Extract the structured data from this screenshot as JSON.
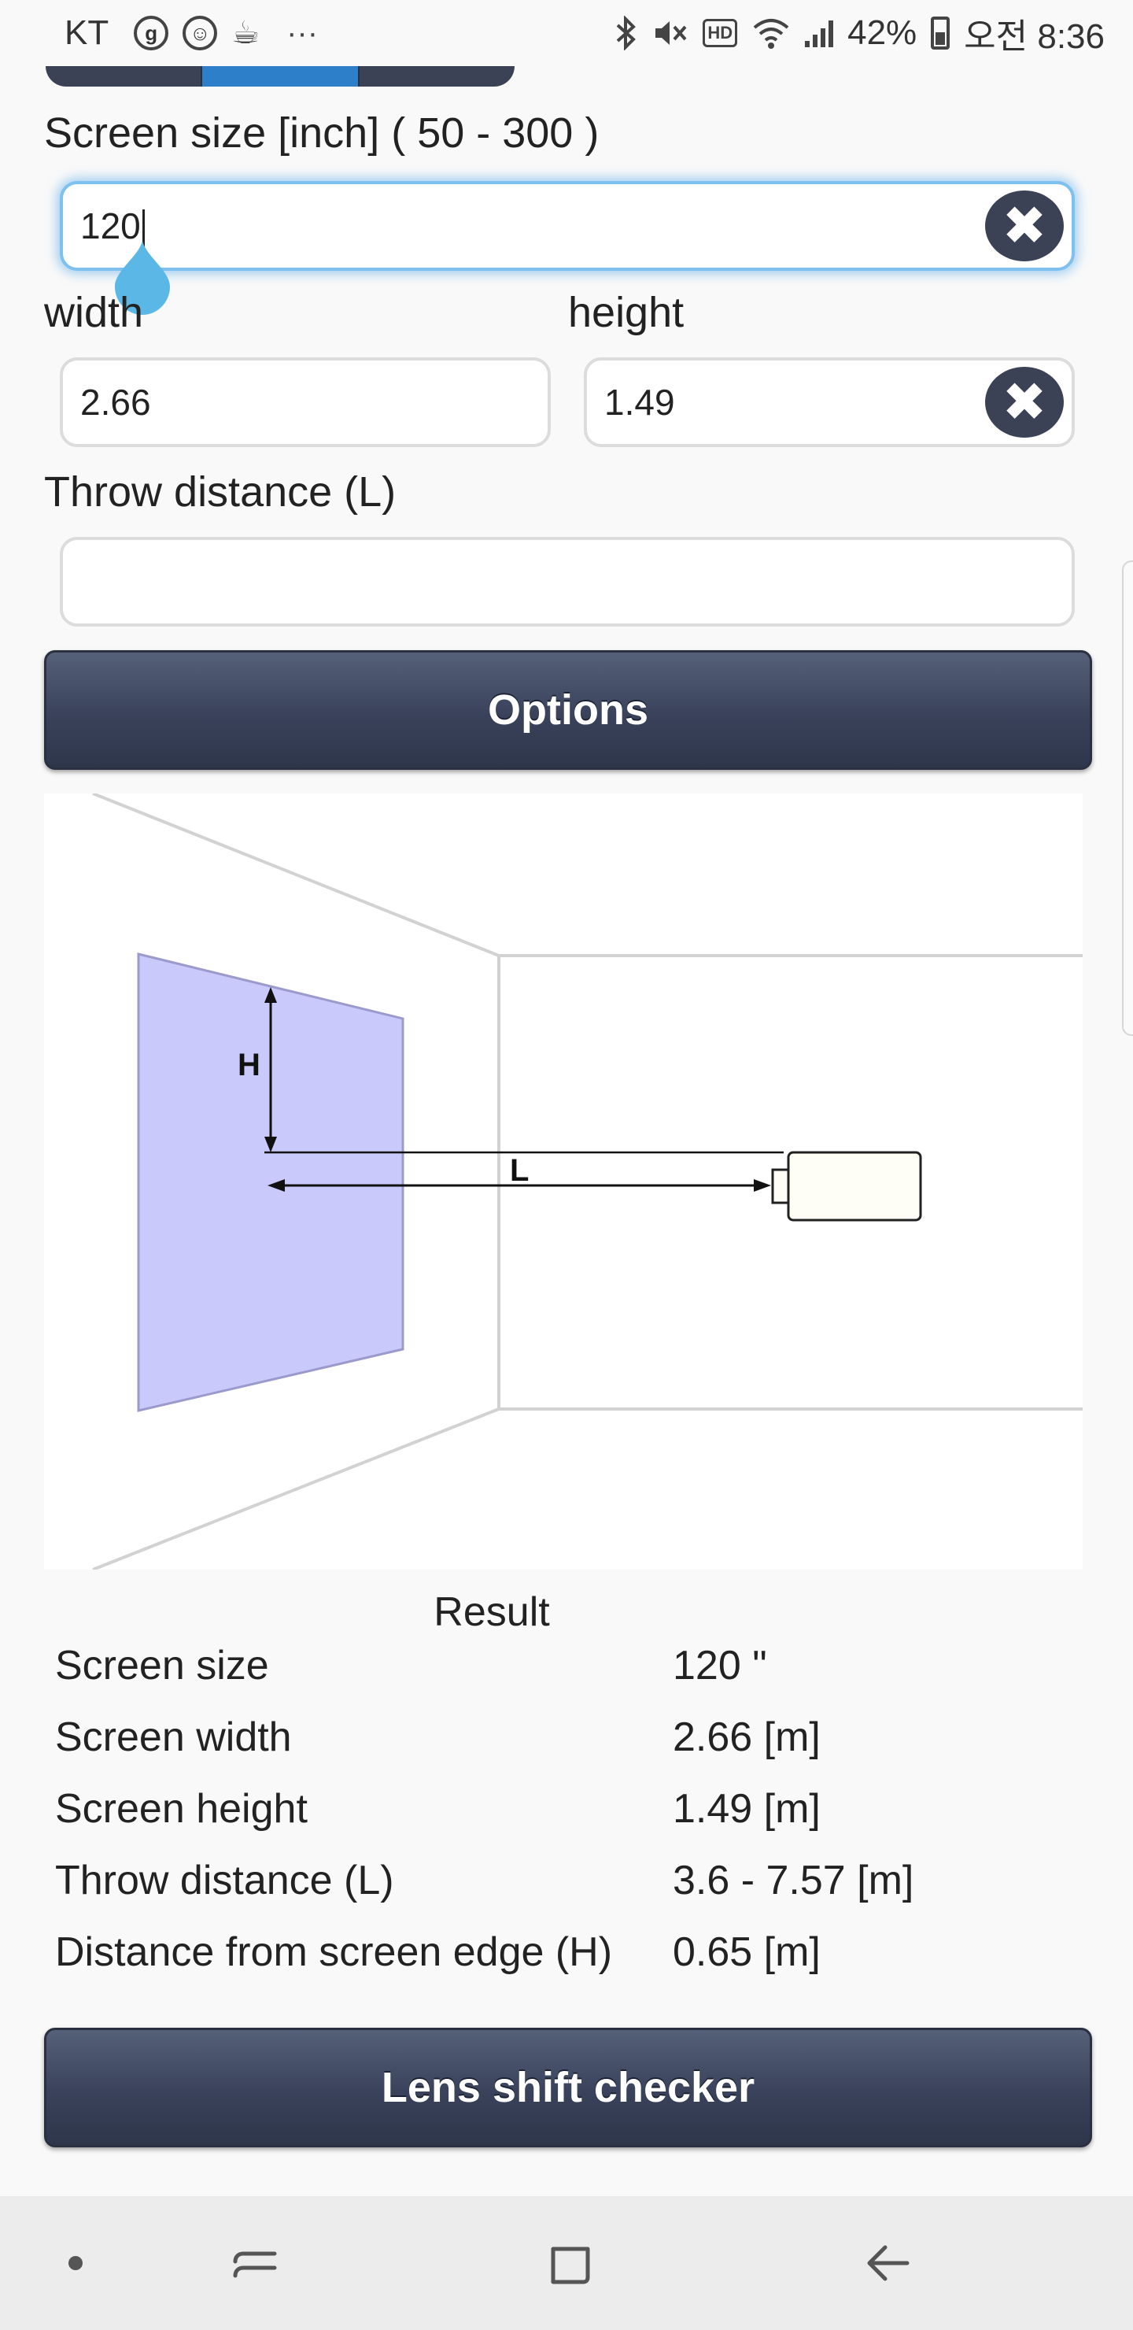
{
  "status_bar": {
    "carrier": "KT",
    "battery": "42%",
    "time": "오전 8:36",
    "more": "···",
    "icons": [
      "g-circle-icon",
      "person-circle-icon",
      "coffee-icon",
      "bluetooth-icon",
      "mute-icon",
      "hd-icon",
      "wifi-icon",
      "signal-icon",
      "battery-icon"
    ],
    "hd_label": "HD"
  },
  "form": {
    "screen_size_label": "Screen size [inch] ( 50 - 300 )",
    "screen_size_value": "120",
    "width_label": "width",
    "width_value": "2.66",
    "height_label": "height",
    "height_value": "1.49",
    "throw_label": "Throw distance (L)",
    "throw_value": "",
    "clear_glyph": "✖"
  },
  "buttons": {
    "options": "Options",
    "lens_shift": "Lens shift checker"
  },
  "diagram": {
    "label_h": "H",
    "label_l": "L",
    "screen_color": "#c9c9fb"
  },
  "result": {
    "title": "Result",
    "rows": [
      {
        "key": "Screen size",
        "value": "120 \""
      },
      {
        "key": "Screen width",
        "value": "2.66 [m]"
      },
      {
        "key": "Screen height",
        "value": "1.49 [m]"
      },
      {
        "key": "Throw distance (L)",
        "value": "3.6 - 7.57 [m]"
      },
      {
        "key": "Distance from screen edge (H)",
        "value": "0.65 [m]"
      }
    ]
  },
  "colors": {
    "accent_dark": "#3b4256",
    "focus_glow": "#58aaeb",
    "tab_active": "#2c7fc8"
  },
  "nav_bar": {
    "items": [
      "dot-icon",
      "recent-apps-icon",
      "home-icon",
      "back-icon"
    ]
  }
}
